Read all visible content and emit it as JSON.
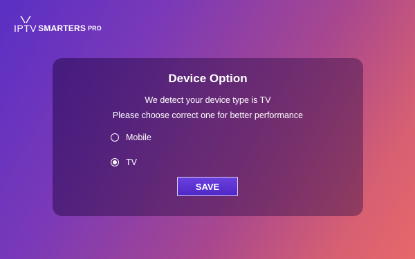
{
  "logo": {
    "iptv": "IPTV",
    "smarters": "SMARTERS",
    "pro": "PRO",
    "icon": "tv-antenna-icon"
  },
  "dialog": {
    "title": "Device Option",
    "message_line1": "We detect your device type is TV",
    "message_line2": "Please choose correct one for better performance",
    "options": [
      {
        "label": "Mobile",
        "selected": false
      },
      {
        "label": "TV",
        "selected": true
      }
    ],
    "save_label": "SAVE"
  },
  "colors": {
    "background_start": "#5a2fc4",
    "background_end": "#e7686a",
    "button": "#5a30d4"
  }
}
